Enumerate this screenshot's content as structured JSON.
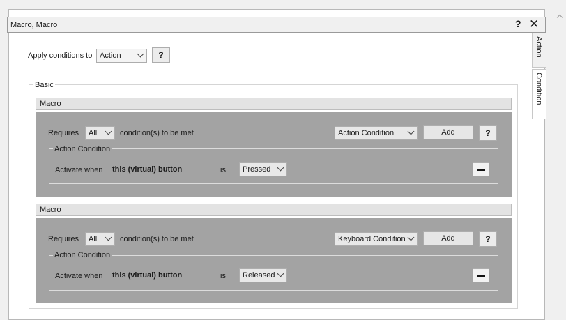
{
  "window": {
    "title": "Macro, Macro",
    "help": "?",
    "close": "✕"
  },
  "apply": {
    "label": "Apply conditions to",
    "value": "Action",
    "help": "?"
  },
  "groupbox": {
    "label": "Basic"
  },
  "tabs": [
    {
      "label": "Action"
    },
    {
      "label": "Condition"
    }
  ],
  "sections": [
    {
      "header": "Macro",
      "requires_label": "Requires",
      "requires_value": "All",
      "requires_suffix": "condition(s) to be met",
      "condition_type": "Action Condition",
      "add_label": "Add",
      "help": "?",
      "subgroup_label": "Action Condition",
      "activate_label": "Activate when",
      "target": "this (virtual) button",
      "is_label": "is",
      "state_value": "Pressed"
    },
    {
      "header": "Macro",
      "requires_label": "Requires",
      "requires_value": "All",
      "requires_suffix": "condition(s) to be met",
      "condition_type": "Keyboard Condition",
      "add_label": "Add",
      "help": "?",
      "subgroup_label": "Action Condition",
      "activate_label": "Activate when",
      "target": "this (virtual) button",
      "is_label": "is",
      "state_value": "Released"
    }
  ]
}
